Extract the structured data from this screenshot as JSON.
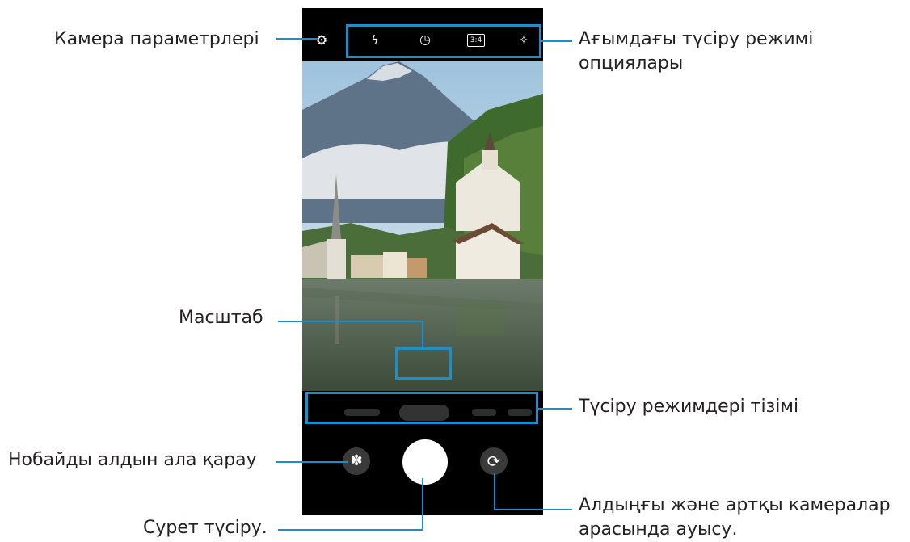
{
  "labels": {
    "camera_settings": "Камера параметрлері",
    "current_mode_options_line1": "Ағымдағы түсіру режимі",
    "current_mode_options_line2": "опциялары",
    "zoom": "Масштаб",
    "shooting_modes_list": "Түсіру режимдері тізімі",
    "thumbnail_preview": "Нобайды алдын ала қарау",
    "take_picture": "Сурет түсіру.",
    "switch_cameras_line1": "Алдыңғы және артқы камералар",
    "switch_cameras_line2": "арасында ауысу."
  },
  "phone": {
    "top_icons": {
      "settings": "⚙",
      "flash": "ϟ",
      "timer": "◷",
      "ratio": "3:4",
      "effects": "✧"
    },
    "thumbnail_glyph": "✽",
    "switch_glyph": "⟳"
  },
  "colors": {
    "callout_line": "#1a8fd0",
    "phone_bg": "#000000"
  }
}
